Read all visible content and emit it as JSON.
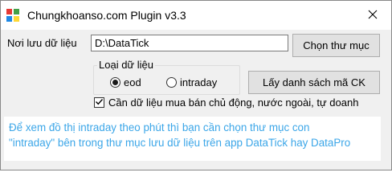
{
  "window": {
    "title": "Chungkhoanso.com Plugin v3.3"
  },
  "form": {
    "folder_label": "Nơi lưu dữ liệu",
    "folder_value": "D:\\DataTick",
    "choose_folder_button": "Chọn thư mục",
    "data_type_group": {
      "legend": "Loại dữ liệu",
      "options": [
        {
          "label": "eod",
          "selected": true
        },
        {
          "label": "intraday",
          "selected": false
        }
      ]
    },
    "get_list_button": "Lấy danh sách mã CK",
    "checkbox": {
      "label": "Cần dữ liệu mua bán chủ động, nước ngoài, tự doanh",
      "checked": true
    }
  },
  "info": {
    "line1": "Để xem đồ thị intraday theo phút thì bạn cần chọn thư mục con",
    "line2": "\"intraday\" bên trong thư mục lưu dữ liệu trên app DataTick hay DataPro",
    "color": "#3ba6e8"
  },
  "icons": {
    "app": "app-icon",
    "close": "close-icon",
    "check": "checkmark-icon"
  }
}
